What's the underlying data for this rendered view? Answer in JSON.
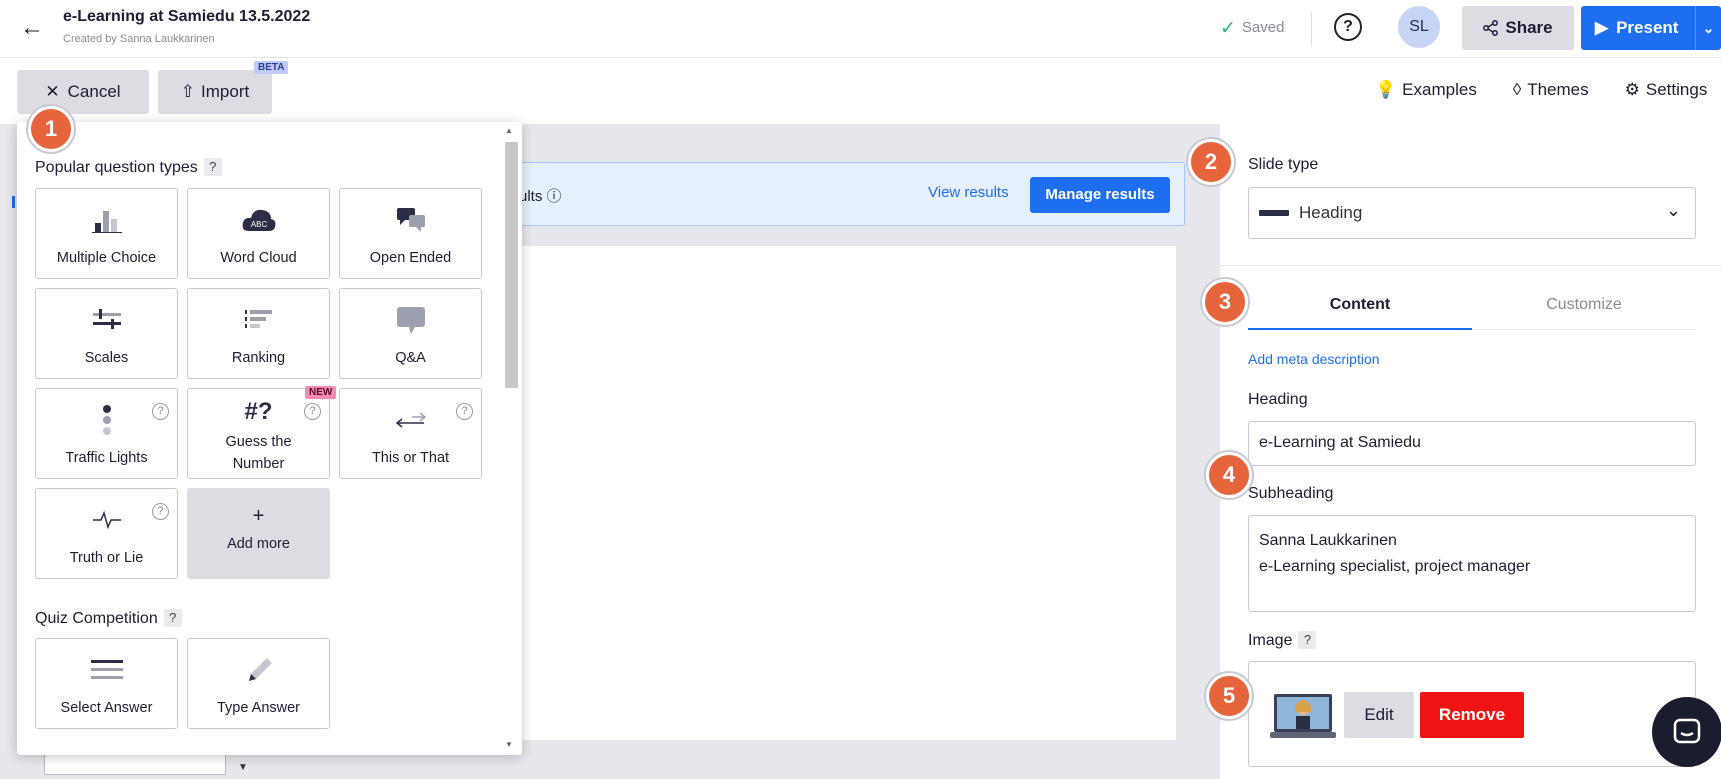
{
  "header": {
    "title": "e-Learning at Samiedu 13.5.2022",
    "subtitle": "Created by Sanna Laukkarinen",
    "saved": "Saved",
    "help": "?",
    "avatar": "SL",
    "share": "Share",
    "present": "Present"
  },
  "toolbar": {
    "cancel": "Cancel",
    "import": "Import",
    "beta": "BETA",
    "examples": "Examples",
    "themes": "Themes",
    "settings": "Settings"
  },
  "results_bar": {
    "text": "ults",
    "view": "View results",
    "manage": "Manage results"
  },
  "popup": {
    "popular_title": "Popular question types",
    "popular_help": "?",
    "tiles": [
      {
        "label": "Multiple Choice",
        "icon": "bar-chart-icon"
      },
      {
        "label": "Word Cloud",
        "icon": "cloud-abc-icon",
        "icon_text": "ABC"
      },
      {
        "label": "Open Ended",
        "icon": "speech-bubbles-icon"
      },
      {
        "label": "Scales",
        "icon": "scales-icon"
      },
      {
        "label": "Ranking",
        "icon": "ranking-icon"
      },
      {
        "label": "Q&A",
        "icon": "qa-bubble-icon"
      },
      {
        "label": "Traffic Lights",
        "icon": "traffic-light-icon"
      },
      {
        "label": "Guess the",
        "label2": "Number",
        "icon": "hash-question-icon",
        "icon_text": "#?",
        "badge": "NEW"
      },
      {
        "label": "This or That",
        "icon": "arrows-icon"
      },
      {
        "label": "Truth or Lie",
        "icon": "pulse-icon"
      },
      {
        "label": "Add more",
        "icon": "plus-icon",
        "icon_text": "+"
      }
    ],
    "quiz_title": "Quiz Competition",
    "quiz_help": "?",
    "quiz_tiles": [
      {
        "label": "Select Answer",
        "icon": "lines-icon"
      },
      {
        "label": "Type Answer",
        "icon": "pencil-icon"
      }
    ],
    "tile_help": "?"
  },
  "markers": [
    "1",
    "2",
    "3",
    "4",
    "5"
  ],
  "right_panel": {
    "slide_type_label": "Slide type",
    "slide_type_value": "Heading",
    "tab_content": "Content",
    "tab_customize": "Customize",
    "add_meta": "Add meta description",
    "heading_label": "Heading",
    "heading_value": "e-Learning at Samiedu",
    "subheading_label": "Subheading",
    "subheading_line1": "Sanna Laukkarinen",
    "subheading_line2": "e-Learning specialist, project manager",
    "image_label": "Image",
    "image_help": "?",
    "edit": "Edit",
    "remove": "Remove"
  },
  "colors": {
    "accent": "#1d6ef0",
    "marker": "#e5643b",
    "remove": "#f01313",
    "saved_check": "#2fb36f"
  }
}
